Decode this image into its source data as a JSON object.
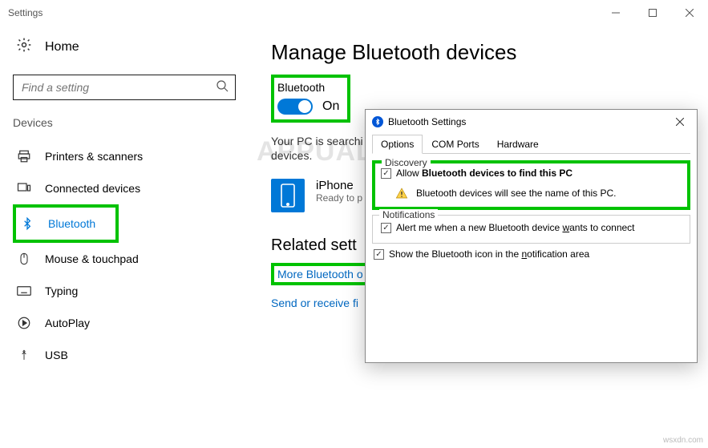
{
  "window": {
    "title": "Settings"
  },
  "sidebar": {
    "home": "Home",
    "search_placeholder": "Find a setting",
    "section": "Devices",
    "items": [
      {
        "label": "Printers & scanners"
      },
      {
        "label": "Connected devices"
      },
      {
        "label": "Bluetooth"
      },
      {
        "label": "Mouse & touchpad"
      },
      {
        "label": "Typing"
      },
      {
        "label": "AutoPlay"
      },
      {
        "label": "USB"
      }
    ]
  },
  "main": {
    "heading": "Manage Bluetooth devices",
    "bt_label": "Bluetooth",
    "bt_state": "On",
    "searching": "Your PC is searchi devices.",
    "device": {
      "name": "iPhone",
      "status": "Ready to p"
    },
    "related_heading": "Related sett",
    "link_more": "More Bluetooth o",
    "link_send": "Send or receive fi"
  },
  "dialog": {
    "title": "Bluetooth Settings",
    "tabs": [
      "Options",
      "COM Ports",
      "Hardware"
    ],
    "discovery": {
      "title": "Discovery",
      "allow_pre": "Allow ",
      "allow_bold": "Bluetooth devices to find this PC",
      "warn": "Bluetooth devices will see the name of this PC."
    },
    "notifications": {
      "title": "Notifications",
      "alert_pre": "Alert me when a new Bluetooth device ",
      "alert_u": "w",
      "alert_post": "ants to connect"
    },
    "trayicon_pre": "Show the Bluetooth icon in the ",
    "trayicon_u": "n",
    "trayicon_post": "otification area"
  },
  "watermark": "APPUALS",
  "credit": "wsxdn.com"
}
